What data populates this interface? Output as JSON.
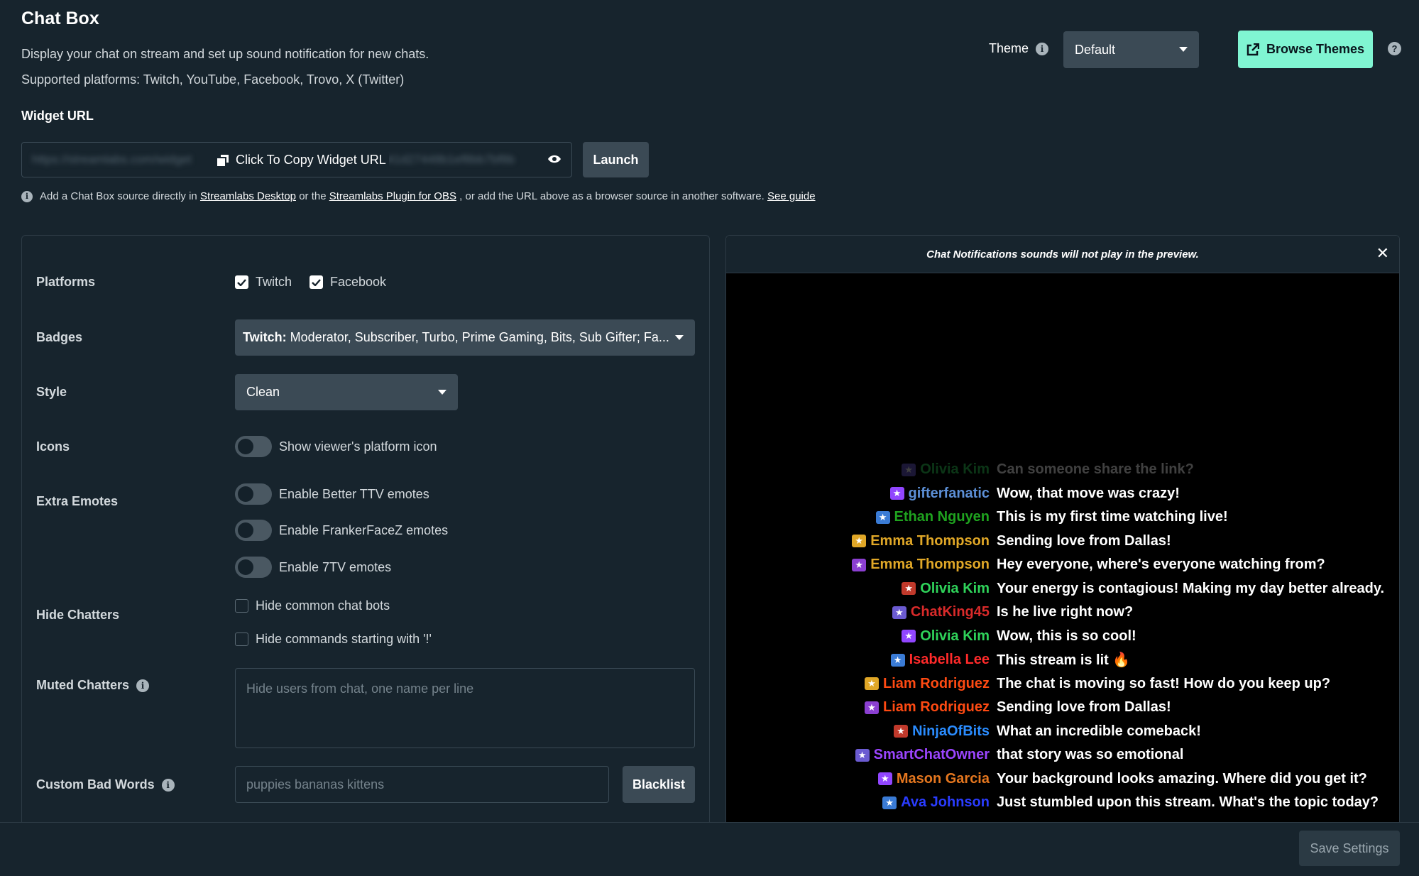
{
  "header": {
    "title": "Chat Box",
    "description": "Display your chat on stream and set up sound notification for new chats.",
    "platforms_supported": "Supported platforms: Twitch, YouTube, Facebook, Trovo, X (Twitter)"
  },
  "theme": {
    "label": "Theme",
    "selected": "Default",
    "browse_label": "Browse Themes",
    "help": "?"
  },
  "widget": {
    "label": "Widget URL",
    "url_blur_left": "https://streamlabs.com/widget",
    "url_blur_right": "e41d27448b1ef8bb7bf8b",
    "copy_label": "Click To Copy Widget URL",
    "launch_label": "Launch",
    "info_prefix": "Add a Chat Box source directly in",
    "link_desktop": "Streamlabs Desktop",
    "info_or": "or the",
    "link_obs": "Streamlabs Plugin for OBS",
    "info_suffix": ", or add the URL above as a browser source in another software.",
    "link_guide": "See guide"
  },
  "settings": {
    "platforms_label": "Platforms",
    "platforms": [
      {
        "label": "Twitch",
        "checked": true
      },
      {
        "label": "Facebook",
        "checked": true
      }
    ],
    "badges_label": "Badges",
    "badges_prefix": "Twitch:",
    "badges_value": "Moderator, Subscriber, Turbo, Prime Gaming, Bits, Sub Gifter; Fa...",
    "style_label": "Style",
    "style_value": "Clean",
    "icons_label": "Icons",
    "icons_toggle": "Show viewer's platform icon",
    "extra_emotes_label": "Extra Emotes",
    "emotes": [
      "Enable Better TTV emotes",
      "Enable FrankerFaceZ emotes",
      "Enable 7TV emotes"
    ],
    "hide_chatters_label": "Hide Chatters",
    "hide_options": [
      "Hide common chat bots",
      "Hide commands starting with '!'"
    ],
    "muted_label": "Muted Chatters",
    "muted_placeholder": "Hide users from chat, one name per line",
    "bad_words_label": "Custom Bad Words",
    "bad_words_placeholder": "puppies bananas kittens",
    "blacklist_label": "Blacklist"
  },
  "preview": {
    "notice": "Chat Notifications sounds will not play in the preview.",
    "close": "✕",
    "messages": [
      {
        "user": "Olivia Kim",
        "text": "Can someone share the link?",
        "color": "#2fd35a"
      },
      {
        "user": "gifterfanatic",
        "text": "Wow, that move was crazy!",
        "color": "#5c8fd6"
      },
      {
        "user": "Ethan Nguyen",
        "text": "This is my first time watching live!",
        "color": "#1fa31f"
      },
      {
        "user": "Emma Thompson",
        "text": "Sending love from Dallas!",
        "color": "#e0a727"
      },
      {
        "user": "Emma Thompson",
        "text": "Hey everyone, where's everyone watching from?",
        "color": "#e0a727"
      },
      {
        "user": "Olivia Kim",
        "text": "Your energy is contagious! Making my day better already.",
        "color": "#2fd35a"
      },
      {
        "user": "ChatKing45",
        "text": "Is he live right now?",
        "color": "#d92a2a"
      },
      {
        "user": "Olivia Kim",
        "text": "Wow, this is so cool!",
        "color": "#2fd35a"
      },
      {
        "user": "Isabella Lee",
        "text": "This stream is lit 🔥",
        "color": "#ff2a2a"
      },
      {
        "user": "Liam Rodriguez",
        "text": "The chat is moving so fast! How do you keep up?",
        "color": "#ff4a12"
      },
      {
        "user": "Liam Rodriguez",
        "text": "Sending love from Dallas!",
        "color": "#ff4a12"
      },
      {
        "user": "NinjaOfBits",
        "text": "What an incredible comeback!",
        "color": "#2a8cff"
      },
      {
        "user": "SmartChatOwner",
        "text": "that story was so emotional",
        "color": "#9b45ff"
      },
      {
        "user": "Mason Garcia",
        "text": "Your background looks amazing. Where did you get it?",
        "color": "#e5771f"
      },
      {
        "user": "Ava Johnson",
        "text": "Just stumbled upon this stream. What's the topic today?",
        "color": "#2a3cff"
      }
    ]
  },
  "footer": {
    "save_label": "Save Settings"
  }
}
